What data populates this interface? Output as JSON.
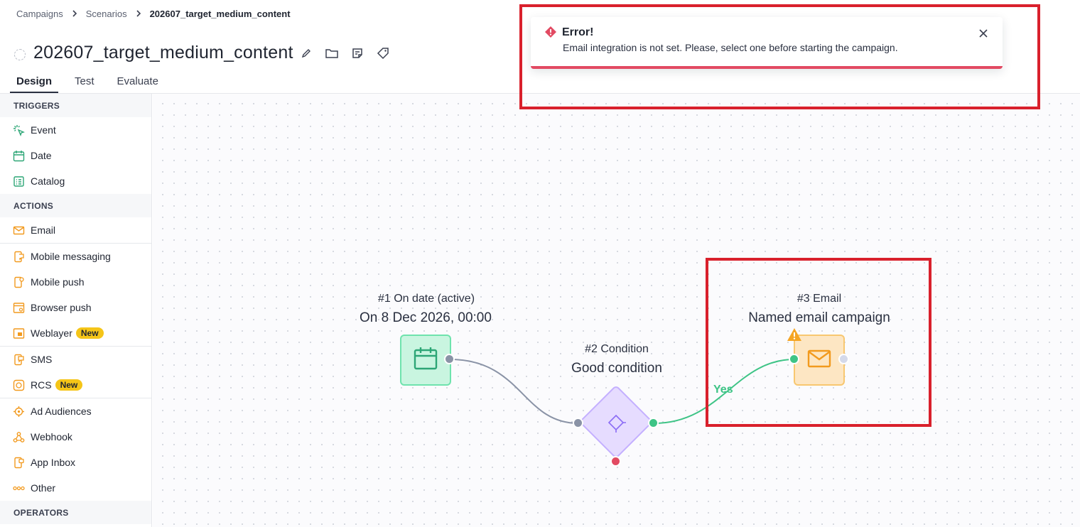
{
  "breadcrumb": {
    "items": [
      "Campaigns",
      "Scenarios",
      "202607_target_medium_content"
    ]
  },
  "page": {
    "title": "202607_target_medium_content"
  },
  "tabs": [
    {
      "label": "Design",
      "active": true
    },
    {
      "label": "Test",
      "active": false
    },
    {
      "label": "Evaluate",
      "active": false
    }
  ],
  "sidebar": {
    "triggers_label": "TRIGGERS",
    "triggers": [
      {
        "label": "Event",
        "icon": "event-icon"
      },
      {
        "label": "Date",
        "icon": "calendar-icon"
      },
      {
        "label": "Catalog",
        "icon": "catalog-icon"
      }
    ],
    "actions_label": "ACTIONS",
    "actions": [
      {
        "label": "Email",
        "icon": "email-icon"
      },
      {
        "label": "Mobile messaging",
        "icon": "mobile-messaging-icon"
      },
      {
        "label": "Mobile push",
        "icon": "mobile-push-icon"
      },
      {
        "label": "Browser push",
        "icon": "browser-push-icon"
      },
      {
        "label": "Weblayer",
        "icon": "weblayer-icon",
        "badge": "New"
      },
      {
        "label": "SMS",
        "icon": "sms-icon"
      },
      {
        "label": "RCS",
        "icon": "rcs-icon",
        "badge": "New"
      },
      {
        "label": "Ad Audiences",
        "icon": "ad-audiences-icon"
      },
      {
        "label": "Webhook",
        "icon": "webhook-icon"
      },
      {
        "label": "App Inbox",
        "icon": "app-inbox-icon"
      },
      {
        "label": "Other",
        "icon": "other-icon"
      }
    ],
    "operators_label": "OPERATORS"
  },
  "nodes": {
    "date": {
      "title": "#1 On date (active)",
      "subtitle": "On 8 Dec 2026, 00:00",
      "color": "#3ecf8e"
    },
    "condition": {
      "title": "#2 Condition",
      "subtitle": "Good condition",
      "color": "#a78bfa"
    },
    "email": {
      "title": "#3 Email",
      "subtitle": "Named email campaign",
      "color": "#f5b642"
    }
  },
  "edges": {
    "yes_label": "Yes"
  },
  "toast": {
    "title": "Error!",
    "message": "Email integration is not set. Please, select one before starting the campaign.",
    "accent": "#e24a62"
  },
  "colors": {
    "action_orange": "#f29a1e",
    "trigger_green": "#2da676",
    "highlight": "#d9202c"
  }
}
